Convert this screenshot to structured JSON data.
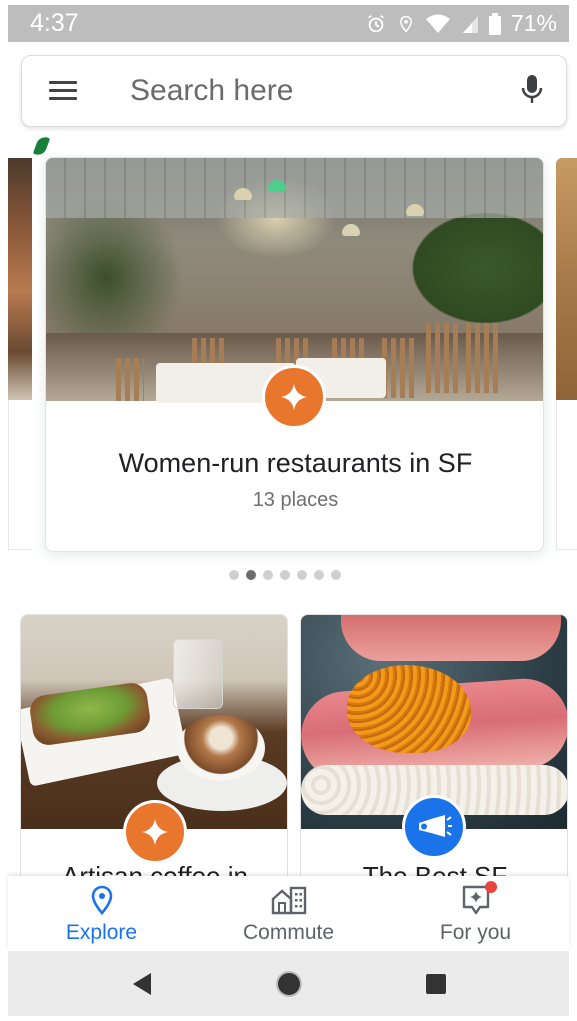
{
  "status_bar": {
    "time": "4:37",
    "battery": "71%"
  },
  "search": {
    "placeholder": "Search here"
  },
  "featured_card": {
    "title": "Women-run restaurants in SF",
    "subtitle": "13 places"
  },
  "carousel": {
    "page_count": 7,
    "active_index": 1
  },
  "grid_cards": [
    {
      "title": "Artisan coffee in",
      "badge": "sparkle-icon"
    },
    {
      "title": "The Best SF",
      "badge": "megaphone-icon"
    }
  ],
  "bottom_nav": {
    "items": [
      {
        "label": "Explore",
        "icon": "location-pin-icon",
        "active": true
      },
      {
        "label": "Commute",
        "icon": "commute-buildings-icon",
        "active": false
      },
      {
        "label": "For you",
        "icon": "for-you-sparkle-icon",
        "active": false,
        "notification": true
      }
    ]
  },
  "colors": {
    "accent": "#1a73e8",
    "badge_orange": "#e8762d",
    "notification_red": "#e8453c"
  }
}
